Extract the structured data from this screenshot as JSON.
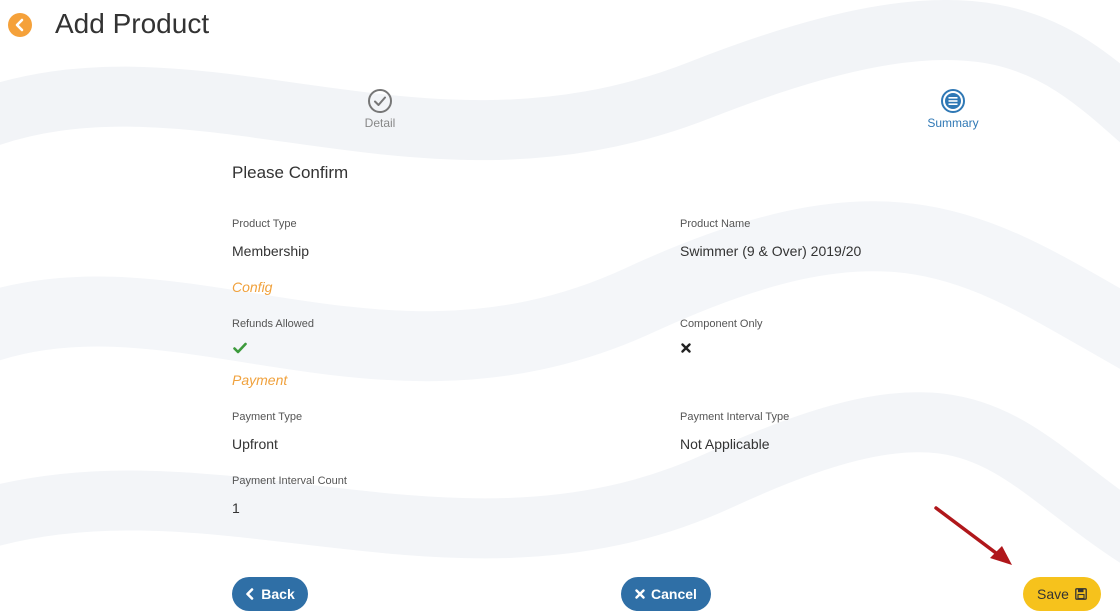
{
  "header": {
    "title": "Add Product"
  },
  "steps": [
    {
      "label": "Detail",
      "state": "complete",
      "icon": "check-circle-icon"
    },
    {
      "label": "Summary",
      "state": "active",
      "icon": "list-circle-icon"
    }
  ],
  "summary": {
    "heading": "Please Confirm",
    "product_type": {
      "label": "Product Type",
      "value": "Membership"
    },
    "product_name": {
      "label": "Product Name",
      "value": "Swimmer (9 & Over) 2019/20"
    },
    "config_section": "Config",
    "refunds_allowed": {
      "label": "Refunds Allowed",
      "value": true,
      "icon": "check-icon"
    },
    "component_only": {
      "label": "Component Only",
      "value": false,
      "icon": "cross-icon"
    },
    "payment_section": "Payment",
    "payment_type": {
      "label": "Payment Type",
      "value": "Upfront"
    },
    "payment_interval_type": {
      "label": "Payment Interval Type",
      "value": "Not Applicable"
    },
    "payment_interval_count": {
      "label": "Payment Interval Count",
      "value": "1"
    }
  },
  "buttons": {
    "back": "Back",
    "cancel": "Cancel",
    "save": "Save"
  },
  "colors": {
    "accent_orange": "#f5a13a",
    "primary_blue": "#2f6fa6",
    "save_yellow": "#f6c21c",
    "check_green": "#3c9a3c",
    "annotation_red": "#b0171b"
  }
}
